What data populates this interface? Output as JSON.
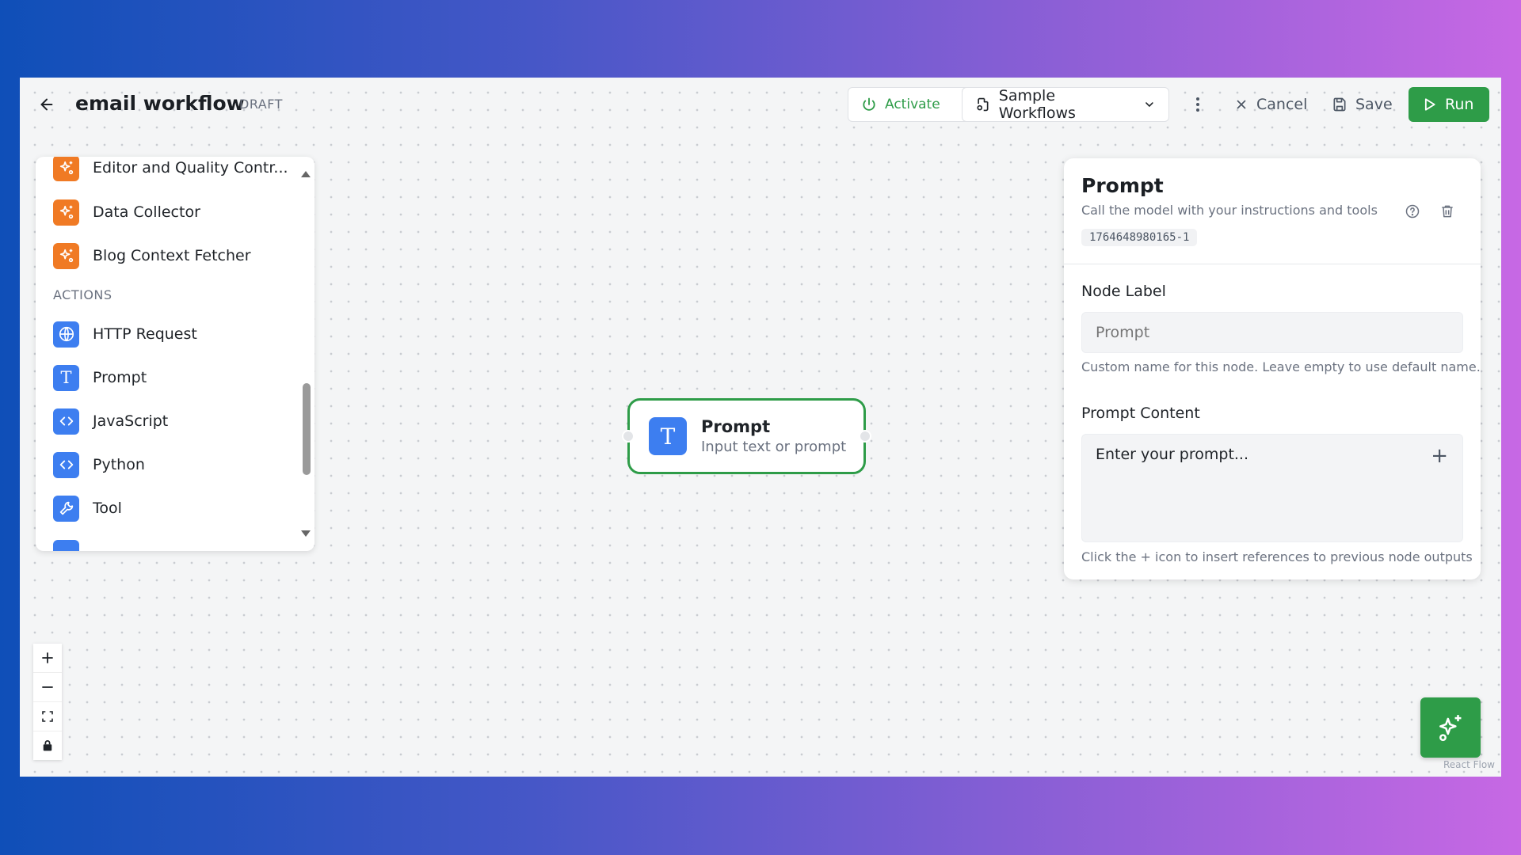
{
  "header": {
    "title": "email workflow",
    "status": "DRAFT",
    "activate_label": "Activate",
    "samples_label": "Sample Workflows",
    "cancel_label": "Cancel",
    "save_label": "Save",
    "run_label": "Run"
  },
  "palette": {
    "items_top": [
      {
        "label": "Editor and Quality Contr...",
        "icon": "agent-sparkle-icon"
      },
      {
        "label": "Data Collector",
        "icon": "agent-sparkle-icon"
      },
      {
        "label": "Blog Context Fetcher",
        "icon": "agent-sparkle-icon"
      }
    ],
    "section_actions": "ACTIONS",
    "items_actions": [
      {
        "label": "HTTP Request",
        "icon": "globe-icon"
      },
      {
        "label": "Prompt",
        "icon": "text-t-icon"
      },
      {
        "label": "JavaScript",
        "icon": "code-icon"
      },
      {
        "label": "Python",
        "icon": "code-icon"
      },
      {
        "label": "Tool",
        "icon": "wrench-icon"
      }
    ]
  },
  "canvas_node": {
    "icon_letter": "T",
    "title": "Prompt",
    "subtitle": "Input text or prompt"
  },
  "panel": {
    "title": "Prompt",
    "description": "Call the model with your instructions and tools",
    "node_id": "1764648980165-1",
    "node_label_title": "Node Label",
    "node_label_placeholder": "Prompt",
    "node_label_help": "Custom name for this node. Leave empty to use default name.",
    "prompt_content_title": "Prompt Content",
    "prompt_placeholder": "Enter your prompt...",
    "prompt_help": "Click the + icon to insert references to previous node outputs"
  },
  "attribution": "React Flow",
  "colors": {
    "accent_green": "#2e9c48",
    "icon_orange": "#f07a24",
    "icon_blue": "#3d7ef0"
  }
}
